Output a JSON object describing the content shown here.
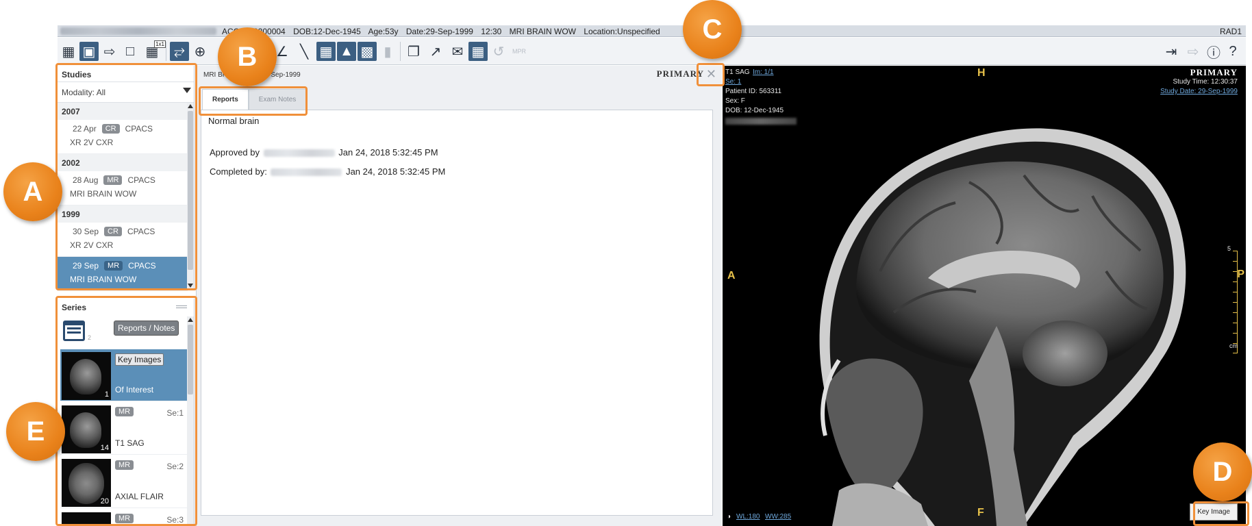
{
  "infobar": {
    "acc": "ACC:GE0200004",
    "dob": "DOB:12-Dec-1945",
    "age": "Age:53y",
    "date": "Date:29-Sep-1999",
    "time": "12:30",
    "study": "MRI BRAIN WOW",
    "location": "Location:Unspecified",
    "user": "RAD1"
  },
  "toolbar": {
    "layout_badge": "1x1"
  },
  "studies": {
    "title": "Studies",
    "modality_filter": "Modality: All",
    "groups": [
      {
        "year": "2007",
        "items": [
          {
            "date": "22 Apr",
            "modality": "CR",
            "source": "CPACS",
            "desc": "XR 2V CXR"
          }
        ]
      },
      {
        "year": "2002",
        "items": [
          {
            "date": "28 Aug",
            "modality": "MR",
            "source": "CPACS",
            "desc": "MRI BRAIN WOW"
          }
        ]
      },
      {
        "year": "1999",
        "items": [
          {
            "date": "30 Sep",
            "modality": "CR",
            "source": "CPACS",
            "desc": "XR 2V CXR"
          },
          {
            "date": "29 Sep",
            "modality": "MR",
            "source": "CPACS",
            "desc": "MRI BRAIN WOW"
          }
        ]
      }
    ]
  },
  "series": {
    "title": "Series",
    "reports_button": "Reports / Notes",
    "report_count": "2",
    "items": [
      {
        "badge": "Key Images",
        "number": "",
        "desc": "Of Interest",
        "count": "1"
      },
      {
        "badge": "MR",
        "number": "Se:1",
        "desc": "T1 SAG",
        "count": "14"
      },
      {
        "badge": "MR",
        "number": "Se:2",
        "desc": "AXIAL FLAIR",
        "count": "20"
      },
      {
        "badge": "MR",
        "number": "Se:3",
        "desc": "",
        "count": ""
      }
    ]
  },
  "report": {
    "header": "MRI BRAIN WOW  29-Sep-1999",
    "primary": "PRIMARY",
    "tabs": [
      "Reports",
      "Exam Notes"
    ],
    "text": "Normal brain",
    "approved_label": "Approved by",
    "approved_date": "Jan 24, 2018 5:32:45 PM",
    "completed_label": "Completed by:",
    "completed_date": "Jan 24, 2018 5:32:45 PM"
  },
  "viewer": {
    "series_desc": "T1 SAG",
    "image": "Im: 1/1",
    "series": "Se: 1",
    "patient_id": "Patient ID: 563311",
    "sex": "Sex: F",
    "dob": "DOB: 12-Dec-1945",
    "primary": "PRIMARY",
    "study_time": "Study Time: 12:30:37",
    "study_date": "Study Date: 29-Sep-1999",
    "orient_top": "H",
    "orient_left": "A",
    "orient_right": "P",
    "orient_bottom": "F",
    "scale_top": "5",
    "scale_unit": "cm",
    "wl": "WL:180",
    "ww": "WW:285",
    "key_image_button": "Key Image"
  },
  "callouts": [
    "A",
    "B",
    "C",
    "D",
    "E"
  ],
  "colors": {
    "accent": "#f0903a",
    "selection": "#5b8fb8",
    "orientation": "#e8c24a"
  }
}
